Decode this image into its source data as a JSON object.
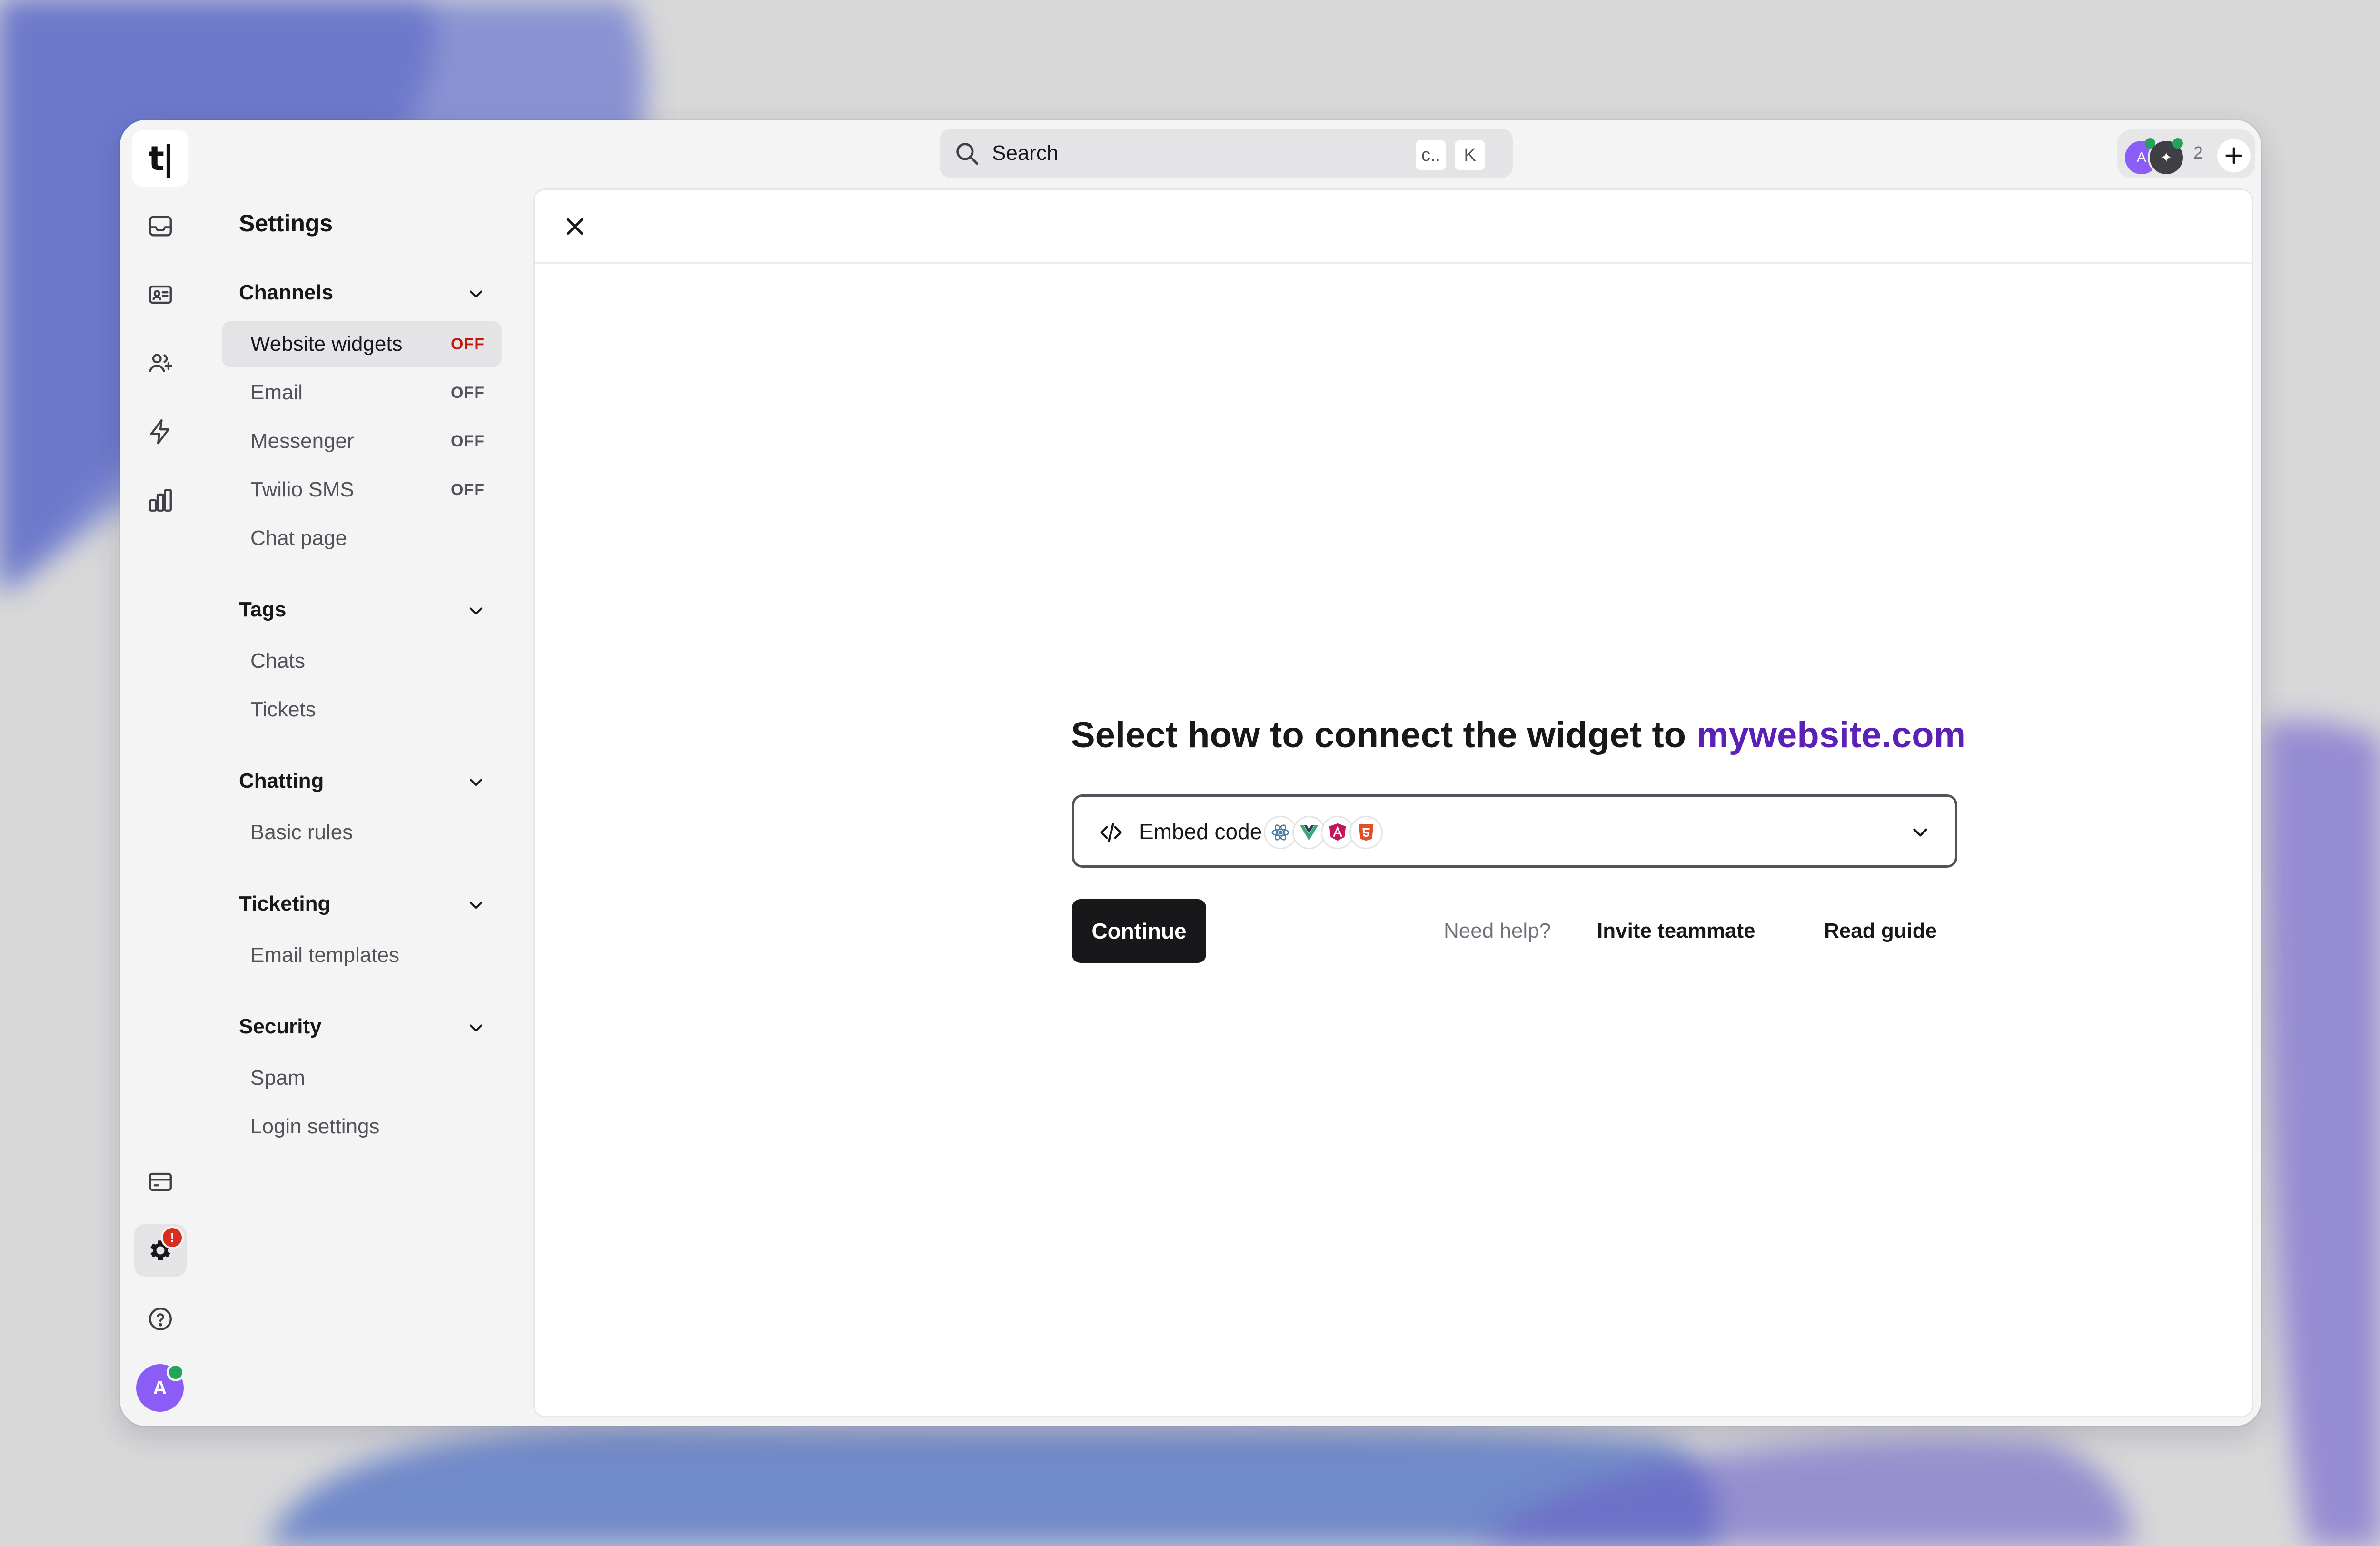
{
  "app": {
    "logo": "t|"
  },
  "search": {
    "placeholder": "Search",
    "shortcut_1": "c..",
    "shortcut_2": "K"
  },
  "top_right": {
    "avatar_1": "A",
    "avatar_2": "✦",
    "count": "2"
  },
  "rail": {
    "icons": [
      "inbox-icon",
      "contact-card-icon",
      "users-add-icon",
      "lightning-icon",
      "bar-chart-icon",
      "billing-card-icon",
      "settings-gear-icon",
      "help-circle-icon"
    ],
    "alert_badge": "!",
    "user_avatar": "A"
  },
  "sidebar": {
    "title": "Settings",
    "sections": [
      {
        "title": "Channels",
        "items": [
          {
            "label": "Website widgets",
            "status": "OFF"
          },
          {
            "label": "Email",
            "status": "OFF"
          },
          {
            "label": "Messenger",
            "status": "OFF"
          },
          {
            "label": "Twilio SMS",
            "status": "OFF"
          },
          {
            "label": "Chat page",
            "status": ""
          }
        ]
      },
      {
        "title": "Tags",
        "items": [
          {
            "label": "Chats"
          },
          {
            "label": "Tickets"
          }
        ]
      },
      {
        "title": "Chatting",
        "items": [
          {
            "label": "Basic rules"
          }
        ]
      },
      {
        "title": "Ticketing",
        "items": [
          {
            "label": "Email templates"
          }
        ]
      },
      {
        "title": "Security",
        "items": [
          {
            "label": "Spam"
          },
          {
            "label": "Login settings"
          }
        ]
      }
    ],
    "active_item": "Website widgets"
  },
  "main": {
    "headline": "Select how to connect the widget to",
    "website": "mywebsite.com",
    "method_select": {
      "label": "Embed code",
      "framework_icons": [
        "react-icon",
        "vue-icon",
        "angular-icon",
        "html5-icon"
      ]
    },
    "continue_label": "Continue",
    "help_text": "Need help?",
    "invite_label": "Invite teammate",
    "guide_label": "Read guide"
  },
  "colors": {
    "accent_purple": "#5b21b6",
    "off_active": "#c01a0f",
    "online_green": "#22a55a",
    "avatar_purple": "#8b5cf6",
    "primary_button": "#18181b"
  }
}
